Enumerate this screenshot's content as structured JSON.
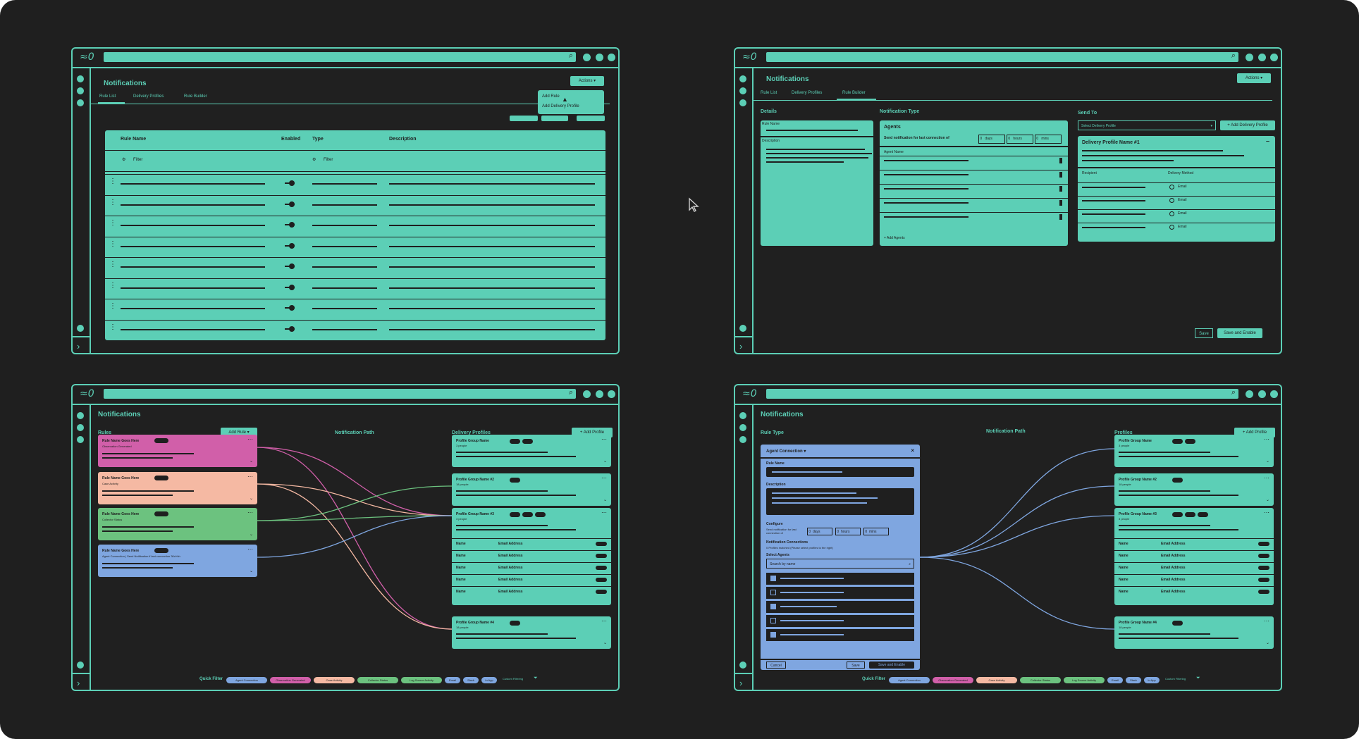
{
  "app": {
    "title": "Notifications",
    "logo": "≈0"
  },
  "common": {
    "save": "Save",
    "save_enable": "Save and Enable",
    "actions": "Actions ▾"
  },
  "w1": {
    "tabs": [
      "Rule List",
      "Delivery Profiles",
      "Rule Builder"
    ],
    "menu": [
      "Add Rule",
      "Add Delivery Profile"
    ],
    "columns": [
      "Rule Name",
      "Enabled",
      "Type",
      "Description"
    ],
    "filter": "Filter"
  },
  "w2": {
    "tabs": [
      "Rule List",
      "Delivery Profiles",
      "Rule Builder"
    ],
    "details": {
      "label": "Details",
      "rule_name": "Rule Name",
      "description": "Description"
    },
    "ntype": {
      "label": "Notification Type",
      "agents": "Agents",
      "send_text": "Send notification for last connection of",
      "days": "days",
      "hours": "hours",
      "mins": "mins",
      "agent_name": "Agent Name",
      "add_agents": "+ Add Agents"
    },
    "sendto": {
      "label": "Send To",
      "select": "Select Delivery Profile",
      "add": "+ Add Delivery Profile",
      "profile": "Delivery Profile Name #1",
      "recipient": "Recipient",
      "method": "Delivery Method",
      "email": "Email"
    }
  },
  "w3": {
    "rules_label": "Rules",
    "add_rule": "Add Rule ▾",
    "path_label": "Notification Path",
    "profiles_label": "Delivery Profiles",
    "add_profile": "+ Add Profile",
    "rules": [
      {
        "name": "Rule Name Goes Here",
        "sub": "Observation Generated",
        "color": "#d15fa9"
      },
      {
        "name": "Rule Name Goes Here",
        "sub": "Case Activity",
        "color": "#f5b9a3"
      },
      {
        "name": "Rule Name Goes Here",
        "sub": "Collector Status",
        "color": "#6cc27f"
      },
      {
        "name": "Rule Name Goes Here",
        "sub": "Agent Connection | Send Notification if last connection 30d+hh",
        "color": "#7fa6e0"
      }
    ],
    "profiles": [
      {
        "name": "Profile Group Name",
        "sub": "3 people"
      },
      {
        "name": "Profile Group Name #2",
        "sub": "18 people"
      },
      {
        "name": "Profile Group Name #3",
        "sub": "3 people"
      },
      {
        "name": "Profile Group Name #4",
        "sub": "18 people"
      }
    ],
    "table_name": "Name",
    "table_email": "Email Address",
    "quick_filter": "Quick Filter",
    "chips": [
      {
        "label": "Agent Connection",
        "color": "#7fa6e0"
      },
      {
        "label": "Observation Generated",
        "color": "#d15fa9"
      },
      {
        "label": "Case Activity",
        "color": "#f5b9a3"
      },
      {
        "label": "Collector Status",
        "color": "#6cc27f"
      },
      {
        "label": "Log Source Activity",
        "color": "#6cc27f"
      },
      {
        "label": "Email",
        "color": "#7fa6e0"
      },
      {
        "label": "Slack",
        "color": "#7fa6e0"
      },
      {
        "label": "In App",
        "color": "#7fa6e0"
      }
    ],
    "custom_filtering": "Custom Filtering"
  },
  "w4": {
    "ruletype_label": "Rule Type",
    "path_label": "Notification Path",
    "profiles_label": "Profiles",
    "add_profile": "+ Add Profile",
    "form": {
      "select": "Agent Connection ▾",
      "rule_name": "Rule Name",
      "description": "Description",
      "configure": "Configure",
      "send_text": "Send notification for last connection of",
      "days": "days",
      "hours": "hours",
      "mins": "mins",
      "nc": "Notification Connections",
      "nc_sub": "0 Profiles matched (Please select profiles to the right)",
      "select_agents": "Select Agents",
      "search": "Search by name",
      "cancel": "Cancel",
      "save": "Save",
      "save_enable": "Save and Enable"
    }
  }
}
